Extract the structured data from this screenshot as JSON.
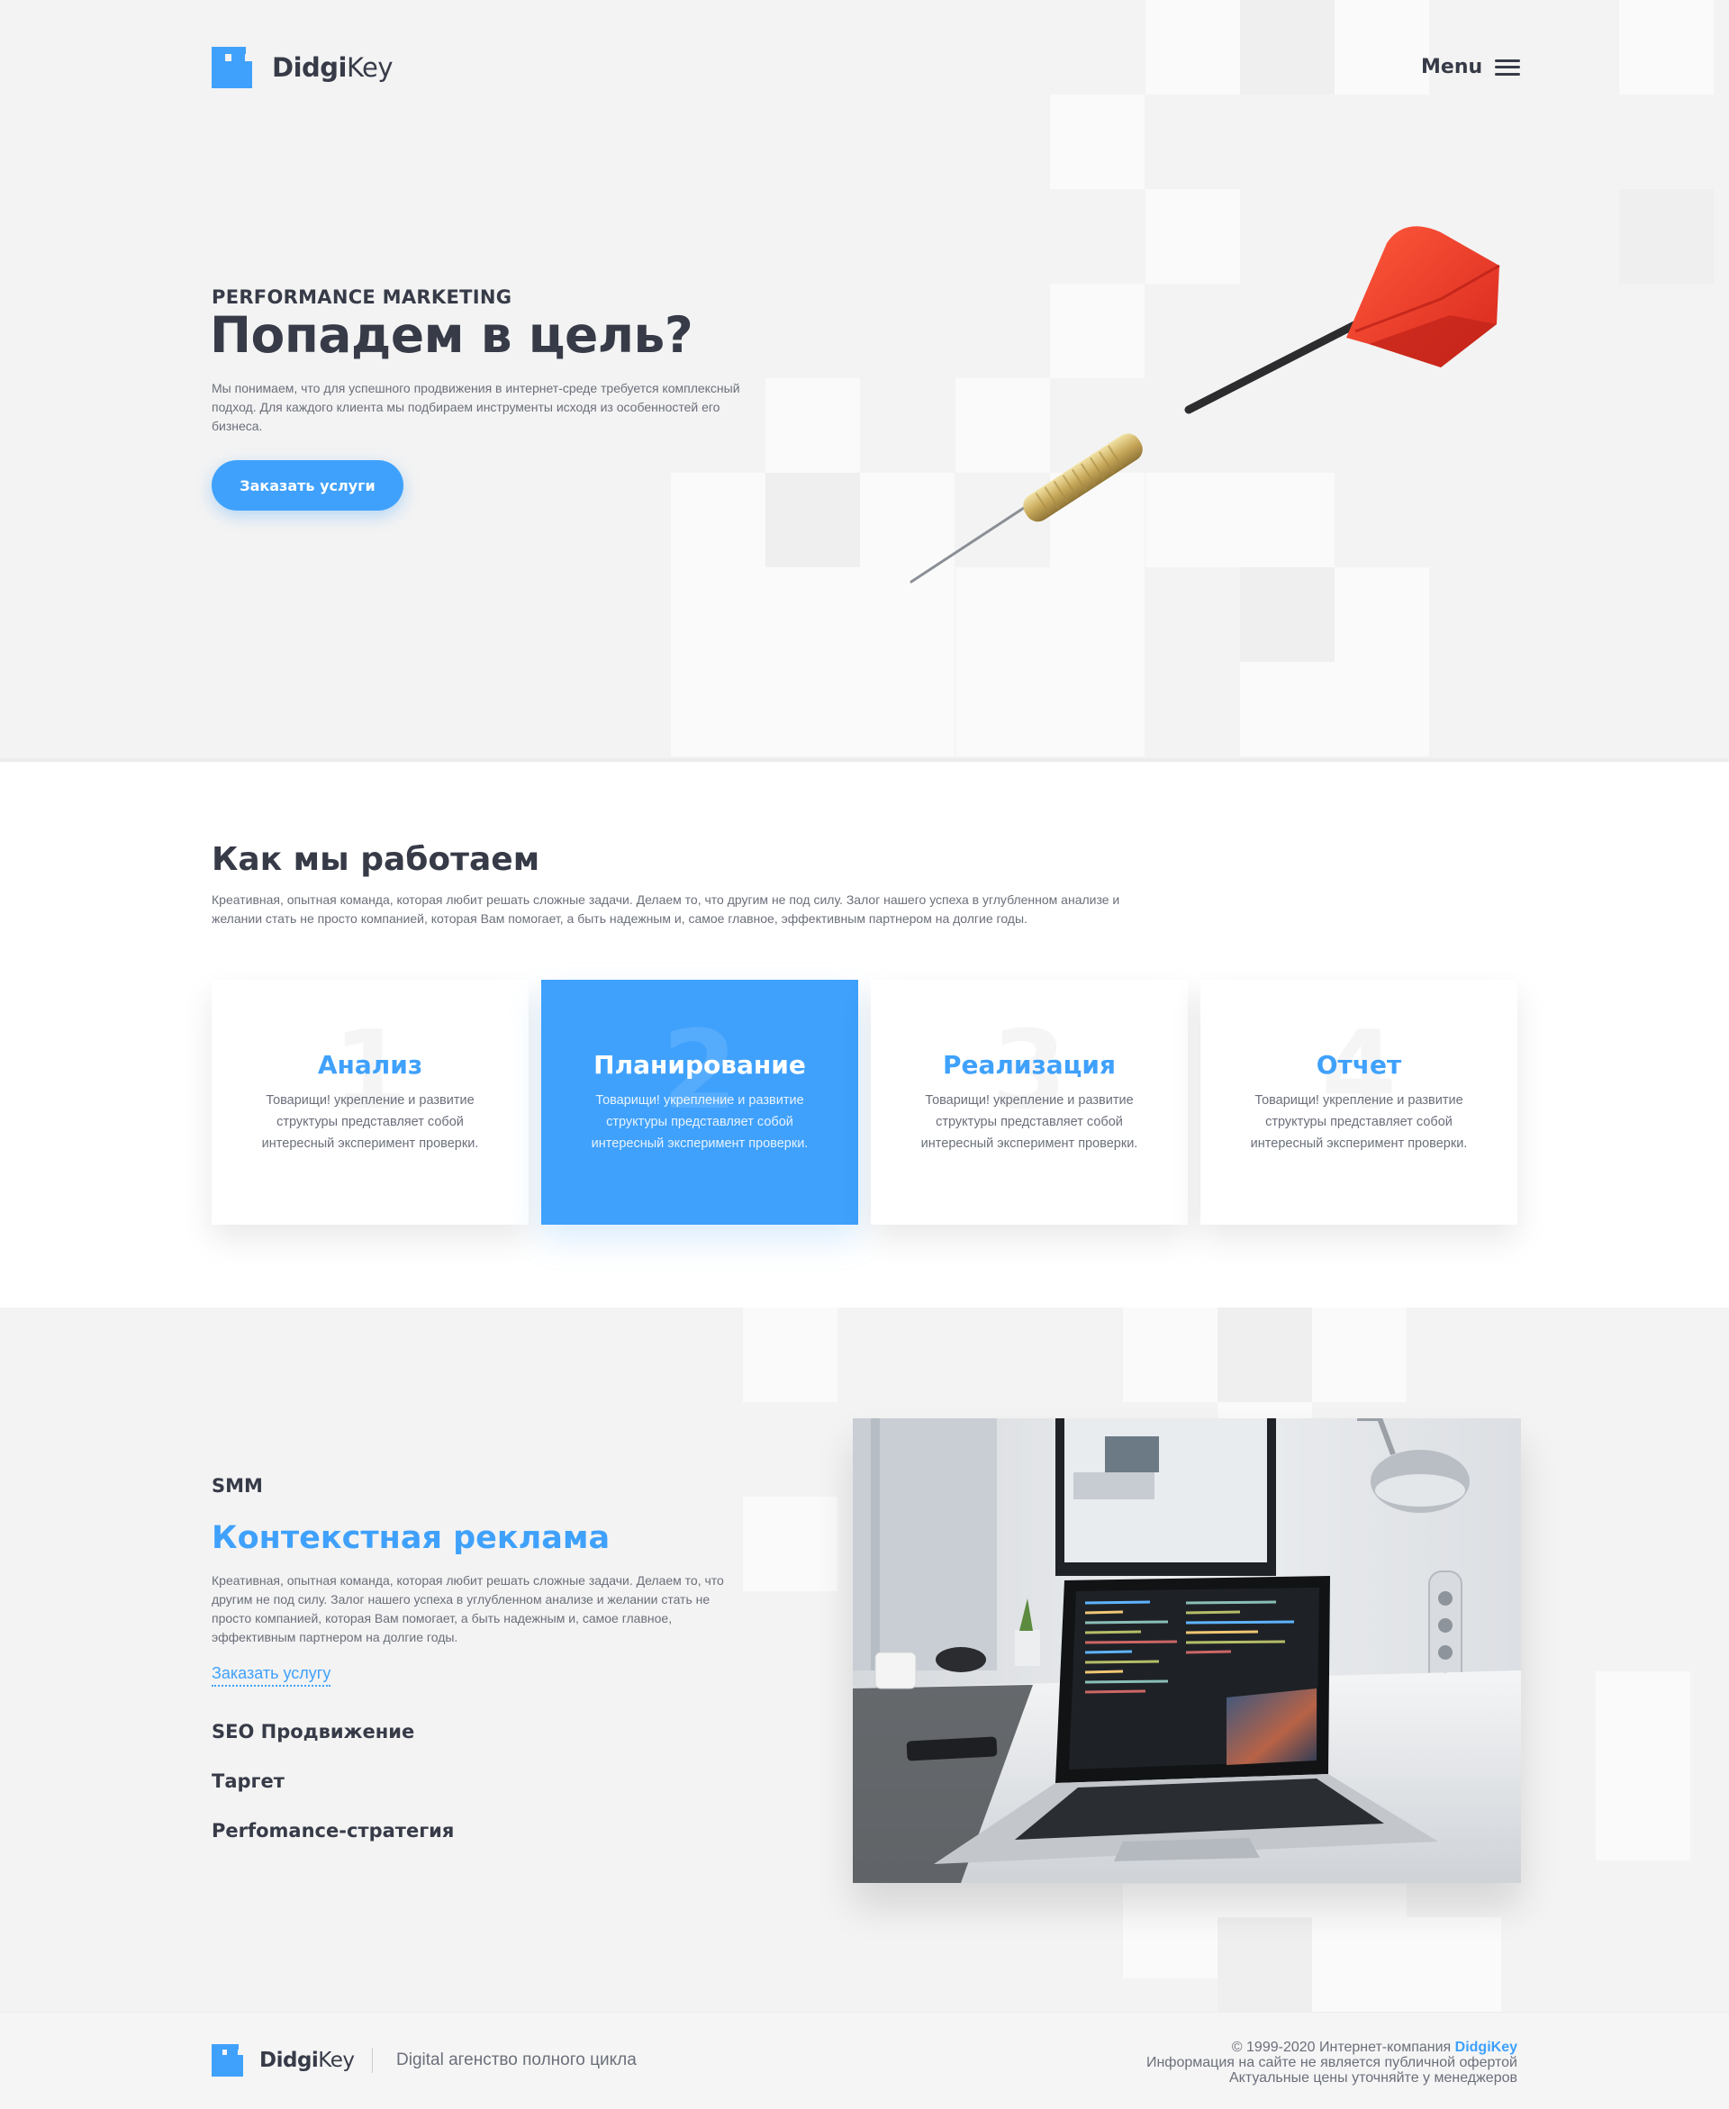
{
  "brand": {
    "name_bold": "Didgi",
    "name_light": "Key",
    "accent_color": "#3fa1fc",
    "text_color": "#373b48"
  },
  "header": {
    "menu_label": "Menu",
    "menu_icon": "hamburger-icon"
  },
  "hero": {
    "eyebrow": "PERFORMANCE MARKETING",
    "title": "Попадем в цель?",
    "description": "Мы понимаем, что для успешного продвижения в интернет-среде требуется комплексный подход. Для каждого клиента мы подбираем инструменты исходя из особенностей его бизнеса.",
    "cta_label": "Заказать услуги",
    "image": "dart-image"
  },
  "how_we_work": {
    "title": "Как мы работаем",
    "description": "Креативная, опытная команда, которая любит решать сложные задачи. Делаем то, что другим не под силу. Залог нашего успеха в углубленном анализе и желании стать не просто компанией, которая Вам помогает, а быть надежным и, самое главное, эффективным партнером на долгие годы.",
    "cards": [
      {
        "number": "1",
        "title": "Анализ",
        "text": "Товарищи! укрепление и развитие структуры представляет собой интересный эксперимент проверки."
      },
      {
        "number": "2",
        "title": "Планирование",
        "text": "Товарищи! укрепление и развитие структуры представляет собой интересный эксперимент проверки."
      },
      {
        "number": "3",
        "title": "Реализация",
        "text": "Товарищи! укрепление и развитие структуры представляет собой интересный эксперимент проверки."
      },
      {
        "number": "4",
        "title": "Отчет",
        "text": "Товарищи! укрепление и развитие структуры представляет собой интересный эксперимент проверки."
      }
    ]
  },
  "services": {
    "smm_label": "SMM",
    "active_title": "Контекстная реклама",
    "active_description": "Креативная, опытная команда, которая любит решать сложные задачи. Делаем то, что другим не под силу. Залог нашего успеха в углубленном анализе и желании стать не просто компанией, которая Вам помогает, а быть надежным и, самое главное, эффективным партнером на долгие годы.",
    "order_link": "Заказать услугу",
    "items": [
      "SEO Продвижение",
      "Таргет",
      "Perfomance-стратегия"
    ],
    "image": "laptop-workspace-photo"
  },
  "footer": {
    "tagline": "Digital агенство полного цикла",
    "copyright_prefix": "© 1999-2020 Интернет-компания",
    "copyright_brand": "DidgiKey",
    "offer_note": "Информация на сайте не является публичной офертой",
    "prices_note": "Актуальные цены уточняйте у менеджеров"
  }
}
